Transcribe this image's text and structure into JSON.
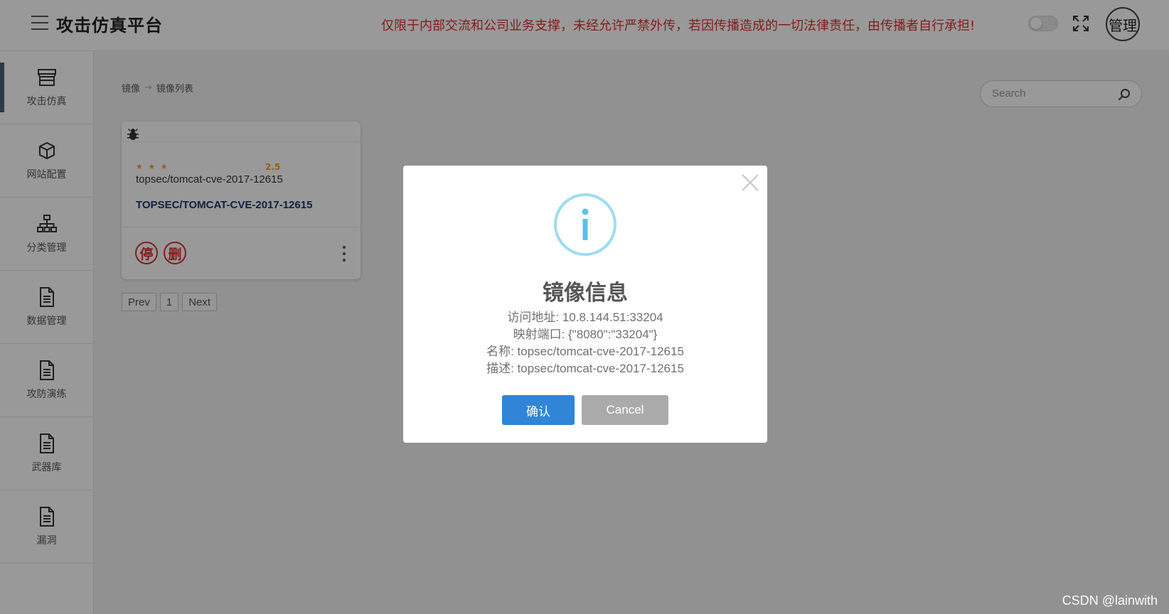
{
  "header": {
    "title": "攻击仿真平台",
    "notice": "仅限于内部交流和公司业务支撑，未经允许严禁外传，若因传播造成的一切法律责任，由传播者自行承担!",
    "user_label": "管理"
  },
  "sidebar": {
    "items": [
      {
        "label": "攻击仿真",
        "icon": "store-icon",
        "active": true
      },
      {
        "label": "网站配置",
        "icon": "cube-icon"
      },
      {
        "label": "分类管理",
        "icon": "sitemap-icon"
      },
      {
        "label": "数据管理",
        "icon": "document-icon"
      },
      {
        "label": "攻防演练",
        "icon": "document-icon"
      },
      {
        "label": "武器库",
        "icon": "document-icon"
      },
      {
        "label": "漏洞",
        "icon": "document-icon"
      }
    ]
  },
  "breadcrumb": {
    "items": [
      "镜像",
      "镜像列表"
    ]
  },
  "search": {
    "placeholder": "Search"
  },
  "card": {
    "icon": "bug-icon",
    "stars": "★ ★ ★",
    "rating": "2.5",
    "repo": "topsec/tomcat-cve-2017-12615",
    "title": "TOPSEC/TOMCAT-CVE-2017-12615",
    "stop_label": "停",
    "delete_label": "删"
  },
  "pagination": {
    "prev": "Prev",
    "page": "1",
    "next": "Next"
  },
  "modal": {
    "title": "镜像信息",
    "lines": [
      "访问地址: 10.8.144.51:33204",
      "映射端口: {\"8080\":\"33204\"}",
      "名称: topsec/tomcat-cve-2017-12615",
      "描述: topsec/tomcat-cve-2017-12615"
    ],
    "confirm": "确认",
    "cancel": "Cancel"
  },
  "colors": {
    "notice": "#e03030",
    "primary": "#3085d6",
    "cancel": "#aaaaaa",
    "info": "#9ddcf3",
    "card_title": "#1d3a66"
  },
  "watermark": "CSDN @lainwith"
}
